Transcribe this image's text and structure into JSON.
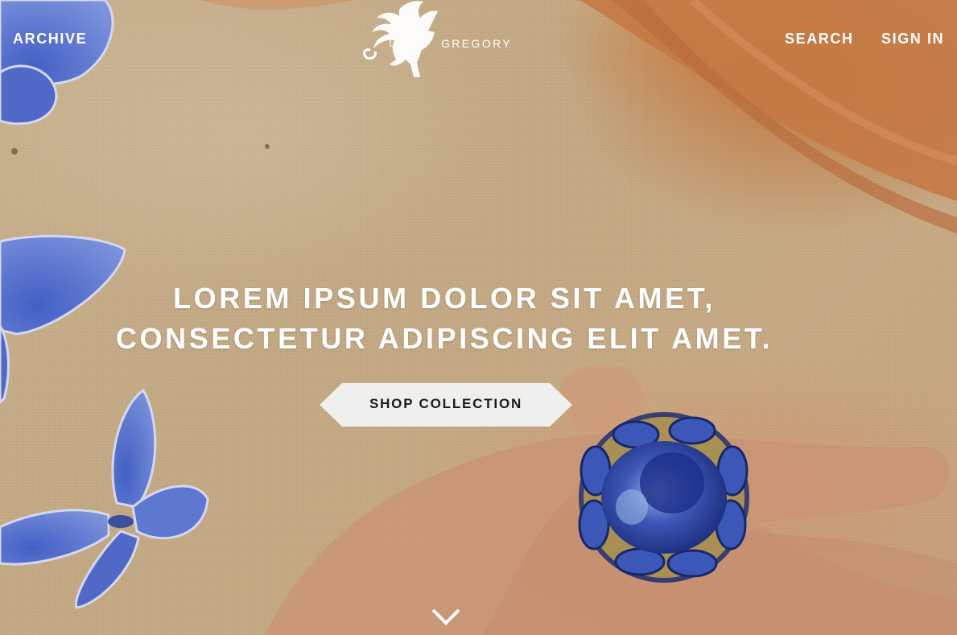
{
  "nav": {
    "archive_label": "ARCHIVE",
    "search_label": "SEARCH",
    "signin_label": "SIGN IN"
  },
  "logo": {
    "initial": "D",
    "wordmark": "GREGORY",
    "icon": "pegasus-icon"
  },
  "hero": {
    "headline_line1": "LOREM IPSUM DOLOR SIT AMET,",
    "headline_line2": "CONSECTETUR ADIPISCING ELIT AMET.",
    "cta_label": "SHOP COLLECTION",
    "scroll_icon": "chevron-down-icon"
  },
  "colors": {
    "butterfly": "#5b74c9",
    "gem": "#2f46a8",
    "hair": "#c4783f",
    "button_bg": "#efefef"
  }
}
